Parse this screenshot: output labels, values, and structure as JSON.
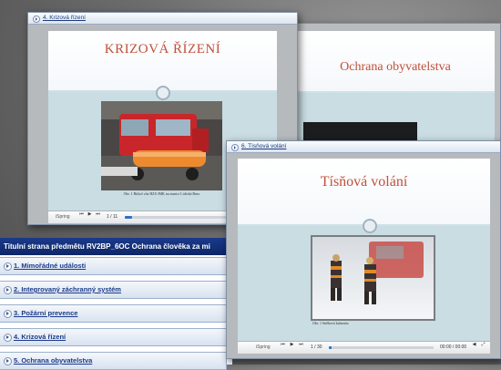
{
  "list": {
    "header": "Titulní strana předmětu RV2BP_6OC Ochrana člověka za mi",
    "items": [
      {
        "label": "1. Mimořádné události"
      },
      {
        "label": "2. Integrovaný záchranný systém"
      },
      {
        "label": "3. Požární prevence"
      },
      {
        "label": "4. Krizová řízení"
      },
      {
        "label": "5. Ochrana obyvatelstva"
      }
    ]
  },
  "window_back": {
    "slide_title": "Ochrana obyvatelstva"
  },
  "window_krizova": {
    "tab_label": "4. Krizová řízení",
    "slide_title": "KRIZOVÁ ŘÍZENÍ",
    "caption": "Obr. 1 Bitbol vůz HZS JMK na stanici Lidická Brno",
    "player": {
      "brand": "iSpring",
      "slide_counter": "1 / 11",
      "progress": 0.05
    }
  },
  "window_tisnova": {
    "tab_label": "6. Tísňová volání",
    "slide_title": "Tísňová volání",
    "caption": "Obr. 1 Sněhová kalamita",
    "player": {
      "brand": "iSpring",
      "slide_counter": "1 / 30",
      "time": "00:00 / 00:00",
      "progress": 0.03
    }
  }
}
